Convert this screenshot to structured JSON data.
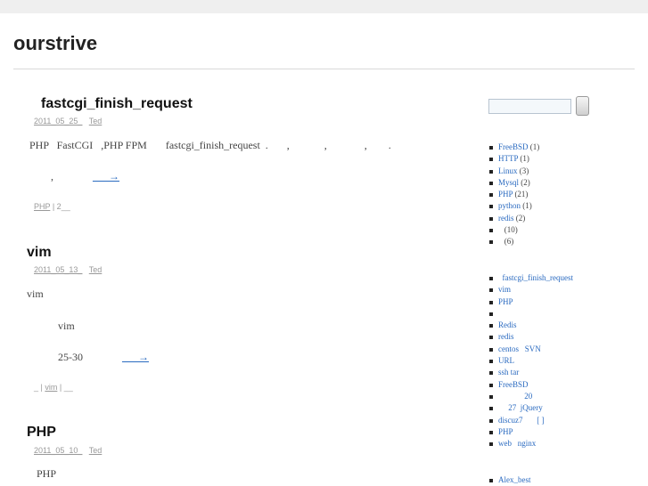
{
  "site": {
    "title": "ourstrive"
  },
  "posts": [
    {
      "title": "fastcgi_finish_request",
      "date": "2011_05_25_",
      "author": "Ted",
      "lines": [
        "PHP   FastCGI   ,PHP FPM       fastcgi_finish_request  .       ,             ,              ,        .",
        "        ,"
      ],
      "more": "___→",
      "footer_prefix": "",
      "footer_link": "PHP",
      "footer_suffix": " | 2__"
    },
    {
      "title": "vim",
      "date": "2011_05_13_",
      "author": "Ted",
      "lines": [
        "vim",
        "vim",
        "25-30"
      ],
      "more": "___→",
      "footer_prefix": "_ | ",
      "footer_link": "vim",
      "footer_suffix": " | __"
    },
    {
      "title": "PHP",
      "date": "2011_05_10_",
      "author": "Ted",
      "lines": [
        "PHP"
      ]
    }
  ],
  "sidebar": {
    "search": {
      "placeholder": "",
      "button_label": ""
    },
    "categories": [
      {
        "label": "FreeBSD",
        "count": "(1)"
      },
      {
        "label": "HTTP",
        "count": "(1)"
      },
      {
        "label": "Linux",
        "count": "(3)"
      },
      {
        "label": "Mysql",
        "count": "(2)"
      },
      {
        "label": "PHP",
        "count": "(21)"
      },
      {
        "label": "python",
        "count": "(1)"
      },
      {
        "label": "redis",
        "count": "(2)"
      },
      {
        "label": "",
        "count": "  (10)"
      },
      {
        "label": "",
        "count": "  (6)"
      }
    ],
    "recent_posts": [
      "  fastcgi_finish_request",
      "vim",
      "PHP",
      "",
      "Redis",
      "redis",
      "centos   SVN",
      "URL",
      "ssh tar",
      "FreeBSD",
      "             20",
      "     27  jQuery",
      "discuz7       [ ]",
      "PHP",
      "web   nginx"
    ],
    "links": [
      "Alex_best"
    ]
  }
}
